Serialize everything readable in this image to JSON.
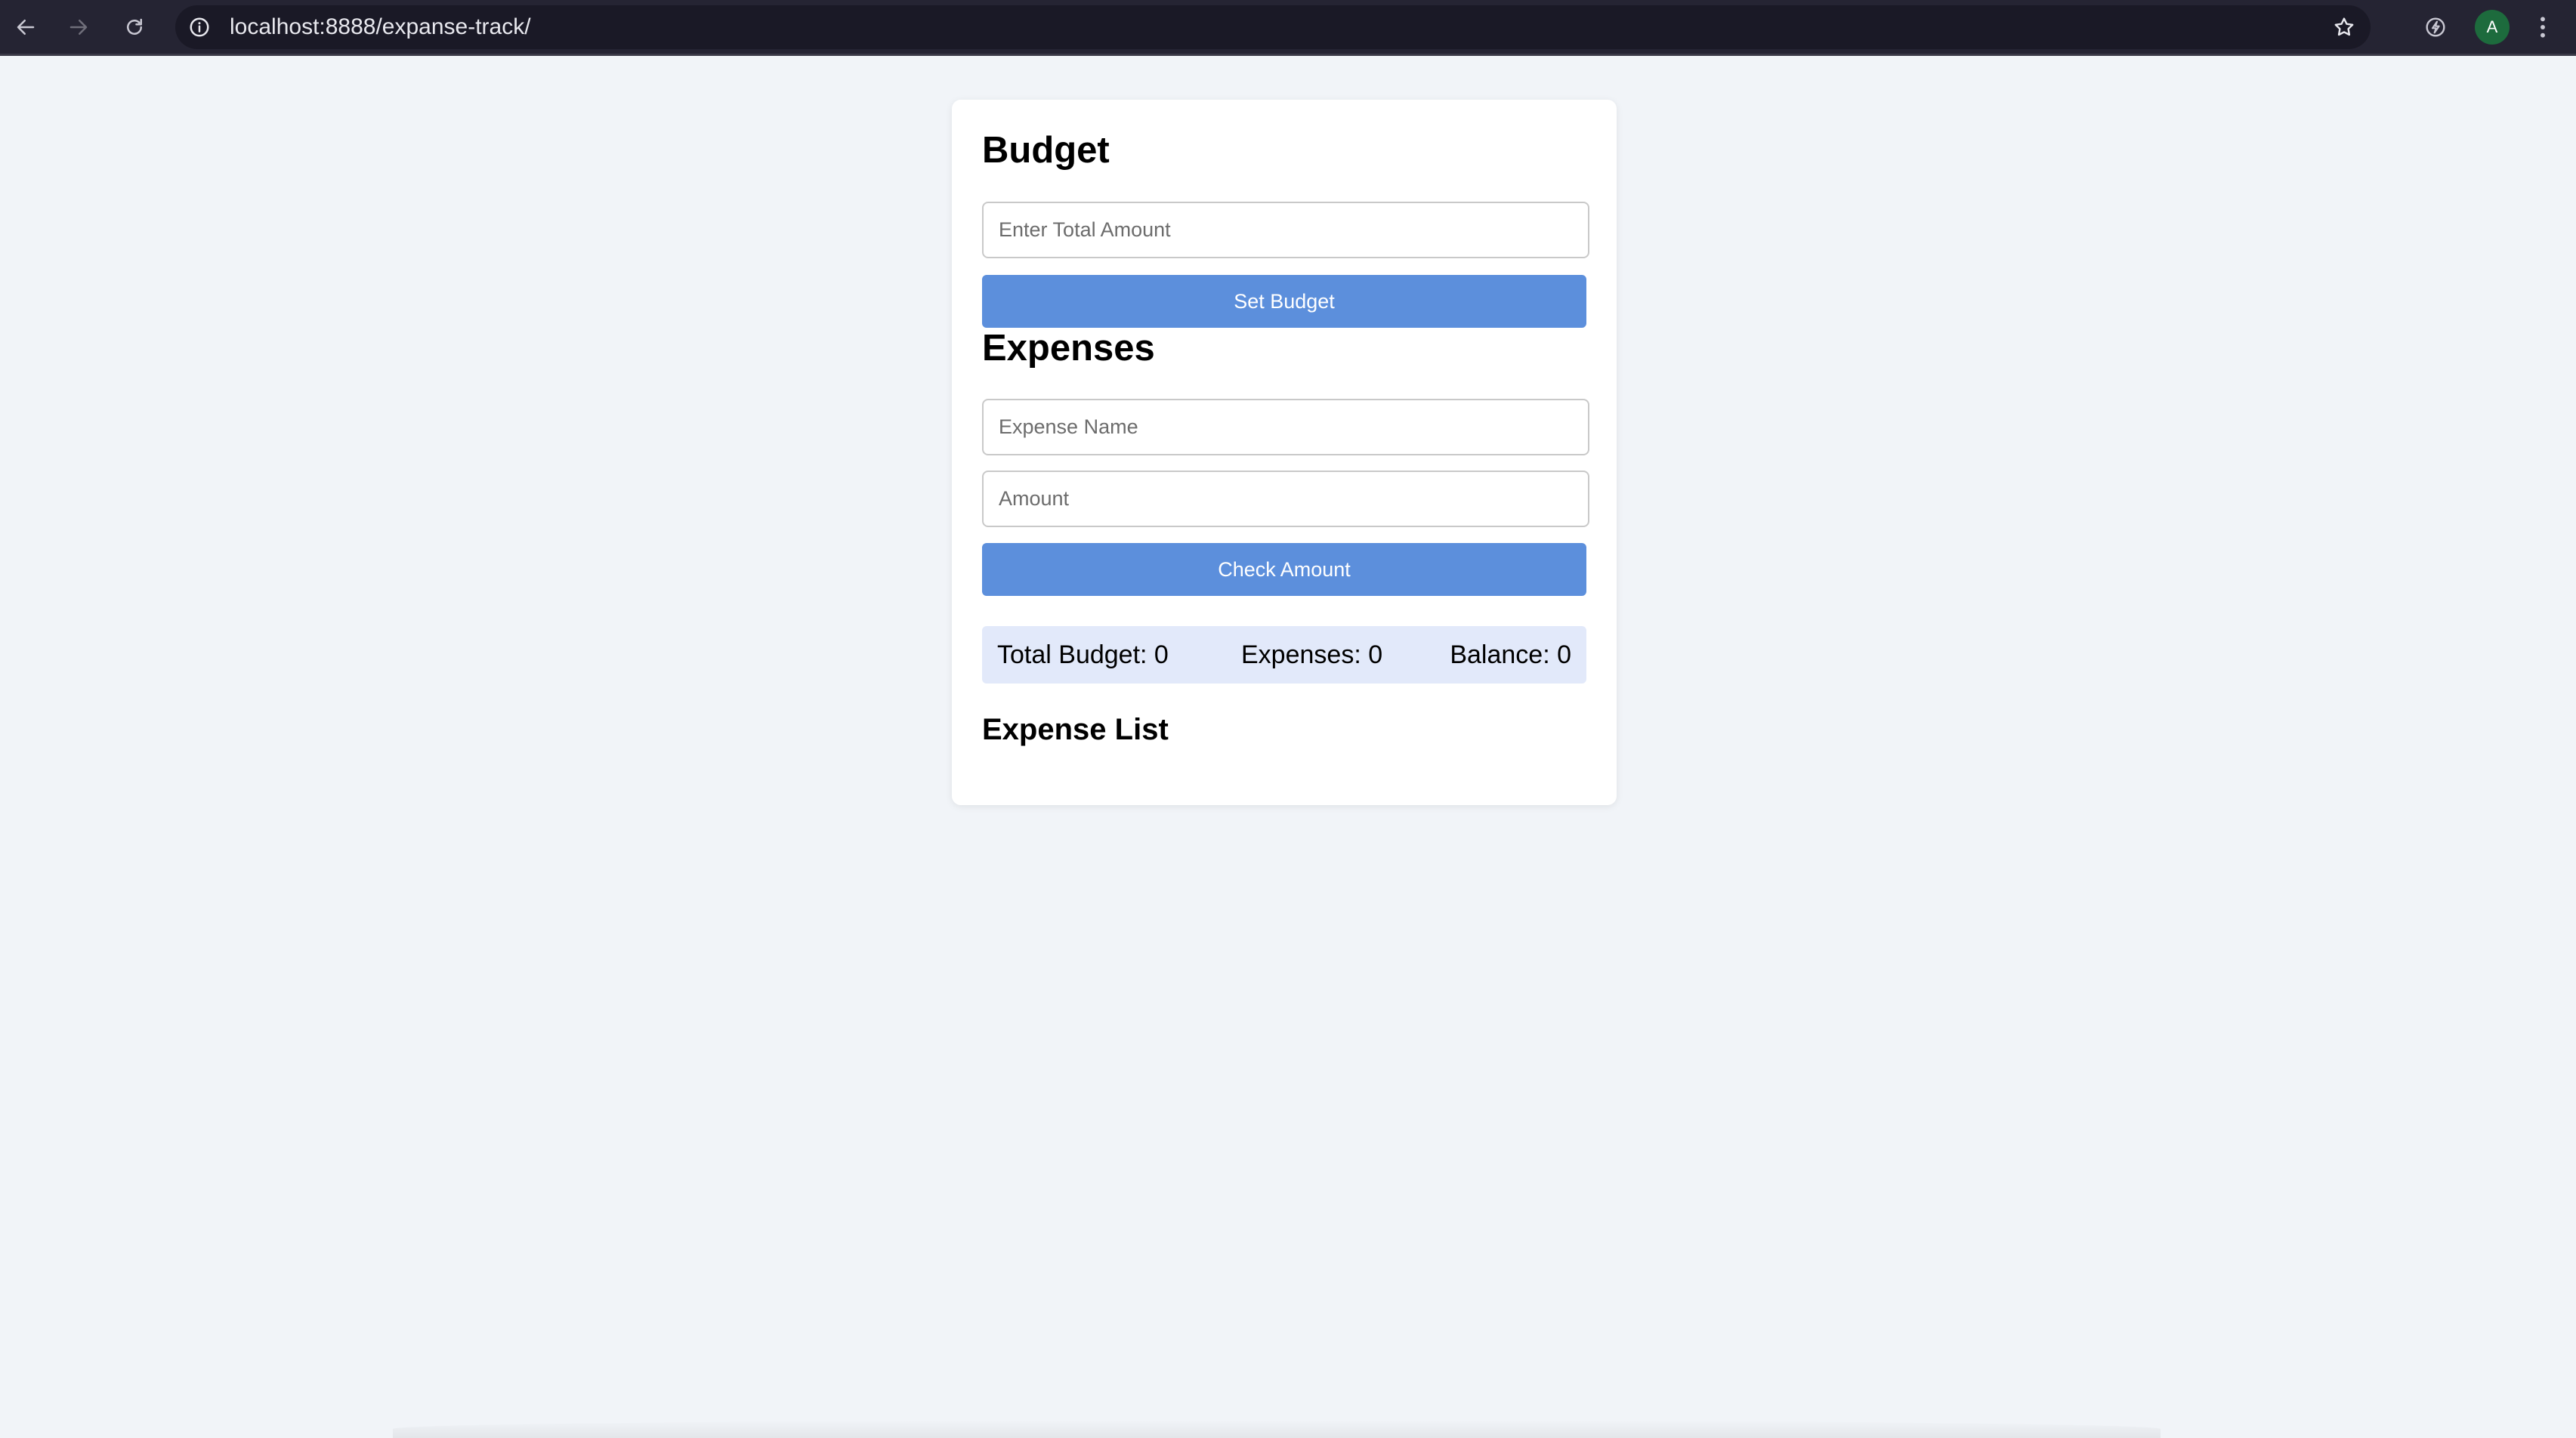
{
  "browser": {
    "url": "localhost:8888/expanse-track/",
    "profile_initial": "A",
    "icons": {
      "back": "arrow-left-icon",
      "forward": "arrow-right-icon",
      "reload": "reload-icon",
      "site_info": "info-icon",
      "bookmark": "star-icon",
      "extension": "extension-icon",
      "menu": "more-vertical-icon"
    }
  },
  "budget": {
    "heading": "Budget",
    "total_placeholder": "Enter Total Amount",
    "total_value": "",
    "set_button": "Set Budget"
  },
  "expenses": {
    "heading": "Expenses",
    "name_placeholder": "Expense Name",
    "name_value": "",
    "amount_placeholder": "Amount",
    "amount_value": "",
    "check_button": "Check Amount"
  },
  "summary": {
    "total_budget": "Total Budget: 0",
    "expenses": "Expenses: 0",
    "balance": "Balance: 0"
  },
  "expense_list": {
    "heading": "Expense List",
    "items": []
  },
  "colors": {
    "page_background": "#f1f4f8",
    "button": "#5c8fdc",
    "summary_background": "#e2e9fa",
    "chrome_bar": "#252433",
    "avatar": "#1d6b3d"
  }
}
